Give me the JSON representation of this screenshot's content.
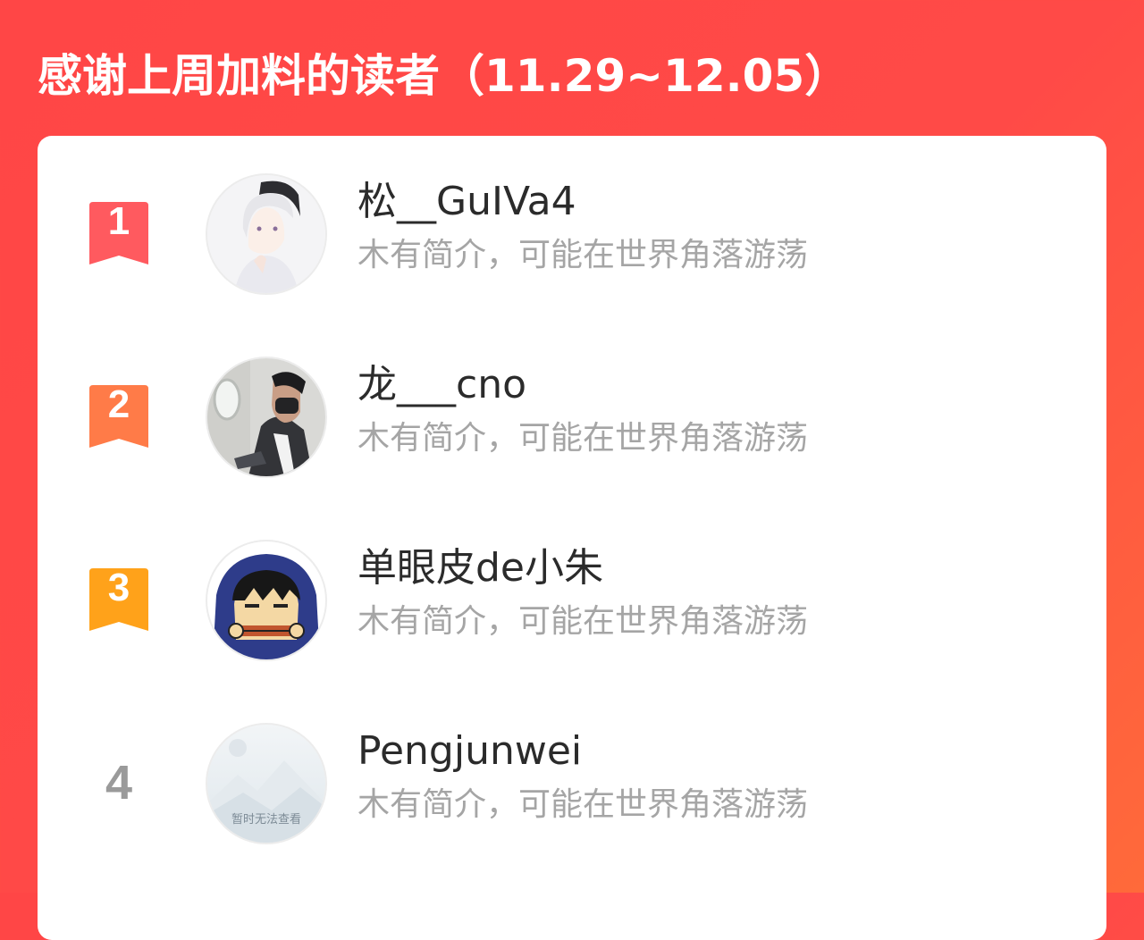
{
  "header": {
    "title": "感谢上周加料的读者（11.29~12.05）"
  },
  "colors": {
    "background_start": "#ff4646",
    "background_end": "#ff6a3a",
    "rank1": "#ff5a5f",
    "rank2": "#ff7b48",
    "rank3": "#ffa21a",
    "rank_plain": "#9a9a9a",
    "name": "#2b2b2b",
    "intro": "#a5a5a5"
  },
  "readers": [
    {
      "rank": "1",
      "name": "松__GuIVa4",
      "intro": "木有简介，可能在世界角落游荡",
      "avatar_icon": "anime-boy-cap-avatar"
    },
    {
      "rank": "2",
      "name": "龙___cno",
      "intro": "木有简介，可能在世界角落游荡",
      "avatar_icon": "man-airplane-mask-avatar"
    },
    {
      "rank": "3",
      "name": "单眼皮de小朱",
      "intro": "木有简介，可能在世界角落游荡",
      "avatar_icon": "cartoon-hoodie-avatar"
    },
    {
      "rank": "4",
      "name": "Pengjunwei",
      "intro": "木有简介，可能在世界角落游荡",
      "avatar_icon": "image-unavailable-placeholder",
      "avatar_caption": "暂时无法查看"
    }
  ]
}
